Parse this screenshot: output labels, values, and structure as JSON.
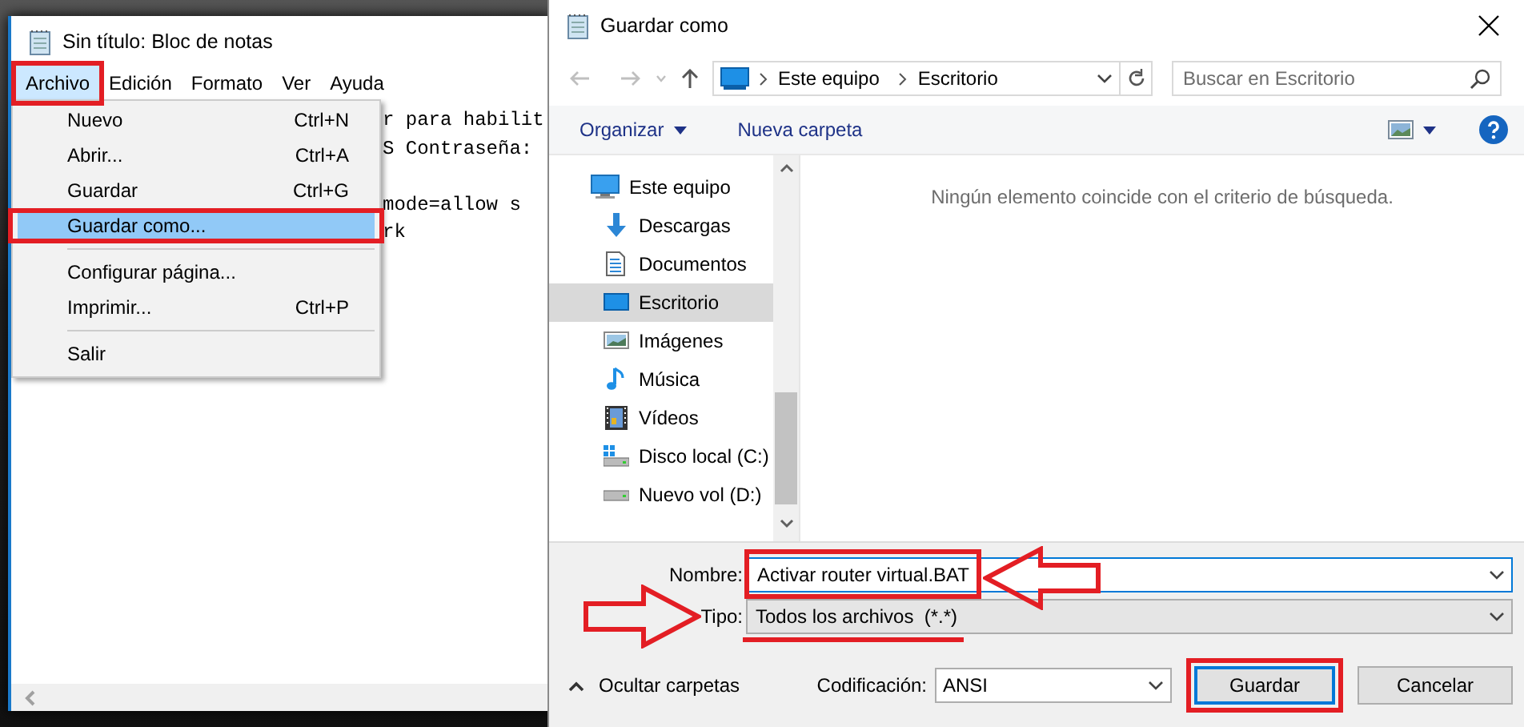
{
  "notepad": {
    "title": "Sin título: Bloc de notas",
    "menubar": [
      {
        "label": "Archivo",
        "selected": true,
        "highlighted": true
      },
      {
        "label": "Edición",
        "selected": false,
        "highlighted": false
      },
      {
        "label": "Formato",
        "selected": false,
        "highlighted": false
      },
      {
        "label": "Ver",
        "selected": false,
        "highlighted": false
      },
      {
        "label": "Ayuda",
        "selected": false,
        "highlighted": false
      }
    ],
    "menu": [
      {
        "kind": "item",
        "label": "Nuevo",
        "shortcut": "Ctrl+N",
        "selected": false,
        "highlighted": false
      },
      {
        "kind": "item",
        "label": "Abrir...",
        "shortcut": "Ctrl+A",
        "selected": false,
        "highlighted": false
      },
      {
        "kind": "item",
        "label": "Guardar",
        "shortcut": "Ctrl+G",
        "selected": false,
        "highlighted": false
      },
      {
        "kind": "item",
        "label": "Guardar como...",
        "selected": true,
        "highlighted": true
      },
      {
        "kind": "separator"
      },
      {
        "kind": "item",
        "label": "Configurar página...",
        "selected": false,
        "highlighted": false
      },
      {
        "kind": "item",
        "label": "Imprimir...",
        "shortcut": "Ctrl+P",
        "selected": false,
        "highlighted": false
      },
      {
        "kind": "separator"
      },
      {
        "kind": "item",
        "label": "Salir",
        "selected": false,
        "highlighted": false
      }
    ],
    "text_lines": [
      {
        "kind": "text",
        "text": "r para habilit"
      },
      {
        "kind": "text",
        "text": "S Contraseña:"
      },
      {
        "kind": "blank"
      },
      {
        "kind": "text",
        "text": "mode=allow s"
      },
      {
        "kind": "text",
        "text": "rk"
      }
    ]
  },
  "dialog": {
    "title": "Guardar como",
    "address": [
      "Este equipo",
      "Escritorio"
    ],
    "search": {
      "placeholder": "Buscar en Escritorio"
    },
    "toolbar": {
      "organize": "Organizar",
      "new_folder": "Nueva carpeta"
    },
    "nav_items": [
      {
        "kind": "computer",
        "label": "Este equipo",
        "selected": false,
        "children": [
          {
            "kind": "downloads",
            "label": "Descargas",
            "selected": false
          },
          {
            "kind": "documents",
            "label": "Documentos",
            "selected": false
          },
          {
            "kind": "desktop",
            "label": "Escritorio",
            "selected": true
          },
          {
            "kind": "pictures",
            "label": "Imágenes",
            "selected": false
          },
          {
            "kind": "music",
            "label": "Música",
            "selected": false
          },
          {
            "kind": "videos",
            "label": "Vídeos",
            "selected": false
          },
          {
            "kind": "system-drive",
            "label": "Disco local (C:)",
            "selected": false
          },
          {
            "kind": "drive",
            "label": "Nuevo vol (D:)",
            "selected": false
          }
        ]
      }
    ],
    "empty_message": "Ningún elemento coincide con el criterio de búsqueda.",
    "filename": {
      "label": "Nombre:",
      "value": "Activar router virtual.BAT",
      "highlighted": true,
      "pointed": true
    },
    "filetype": {
      "label": "Tipo:",
      "value": "Todos los archivos  (*.*)",
      "underlined": true,
      "pointed": true
    },
    "hide_folders": "Ocultar carpetas",
    "encoding": {
      "label": "Codificación:",
      "value": "ANSI"
    },
    "buttons": [
      {
        "kind": "primary",
        "label": "Guardar",
        "highlighted": true
      },
      {
        "kind": "secondary",
        "label": "Cancelar",
        "highlighted": false
      }
    ]
  }
}
